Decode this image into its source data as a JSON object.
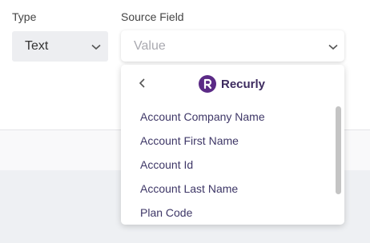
{
  "type_field": {
    "label": "Type",
    "value": "Text"
  },
  "source_field": {
    "label": "Source Field",
    "placeholder": "Value"
  },
  "dropdown": {
    "brand": "Recurly",
    "brand_color": "#5b2a86",
    "options": [
      "Account Company Name",
      "Account First Name",
      "Account Id",
      "Account Last Name",
      "Plan Code"
    ]
  }
}
